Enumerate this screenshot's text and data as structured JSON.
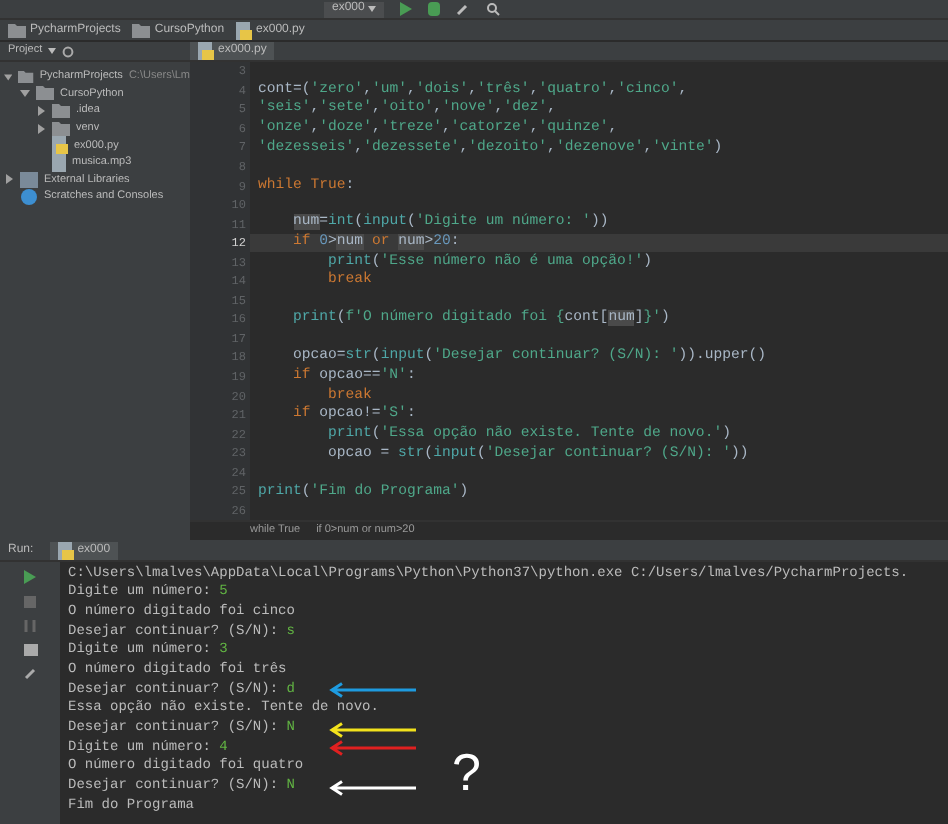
{
  "toolbar": {
    "run_config": "ex000"
  },
  "navigation_bar": [
    "PycharmProjects",
    "CursoPython",
    "ex000.py"
  ],
  "project_panel": {
    "title": "Project",
    "tree": [
      {
        "label": "PycharmProjects",
        "path": "C:\\Users\\Lm",
        "kind": "folder",
        "expanded": true,
        "children": [
          {
            "label": "CursoPython",
            "kind": "folder",
            "expanded": true,
            "children": [
              {
                "label": ".idea",
                "kind": "folder",
                "expanded": false
              },
              {
                "label": "venv",
                "kind": "folder",
                "expanded": false
              },
              {
                "label": "ex000.py",
                "kind": "python"
              },
              {
                "label": "musica.mp3",
                "kind": "file"
              }
            ]
          }
        ]
      },
      {
        "label": "External Libraries",
        "kind": "library",
        "expanded": false
      },
      {
        "label": "Scratches and Consoles",
        "kind": "scratch"
      }
    ]
  },
  "editor": {
    "tab": "ex000.py",
    "lines": [
      {
        "number": "3"
      },
      {
        "number": "4",
        "kind": "top",
        "segments": [
          {
            "kind": "plain",
            "text": "cont=("
          },
          {
            "kind": "str",
            "text": "'zero'"
          },
          {
            "kind": "plain",
            "text": ","
          },
          {
            "kind": "str",
            "text": "'um'"
          },
          {
            "kind": "plain",
            "text": ","
          },
          {
            "kind": "str",
            "text": "'dois'"
          },
          {
            "kind": "plain",
            "text": ","
          },
          {
            "kind": "str",
            "text": "'três'"
          },
          {
            "kind": "plain",
            "text": ","
          },
          {
            "kind": "str",
            "text": "'quatro'"
          },
          {
            "kind": "plain",
            "text": ","
          },
          {
            "kind": "str",
            "text": "'cinco'"
          },
          {
            "kind": "plain",
            "text": ","
          }
        ]
      },
      {
        "number": "5",
        "kind": "top",
        "segments": [
          {
            "kind": "str",
            "text": "'seis'"
          },
          {
            "kind": "plain",
            "text": ","
          },
          {
            "kind": "str",
            "text": "'sete'"
          },
          {
            "kind": "plain",
            "text": ","
          },
          {
            "kind": "str",
            "text": "'oito'"
          },
          {
            "kind": "plain",
            "text": ","
          },
          {
            "kind": "str",
            "text": "'nove'"
          },
          {
            "kind": "plain",
            "text": ","
          },
          {
            "kind": "str",
            "text": "'dez'"
          },
          {
            "kind": "plain",
            "text": ","
          }
        ]
      },
      {
        "number": "6",
        "kind": "top",
        "segments": [
          {
            "kind": "str",
            "text": "'onze'"
          },
          {
            "kind": "plain",
            "text": ","
          },
          {
            "kind": "str",
            "text": "'doze'"
          },
          {
            "kind": "plain",
            "text": ","
          },
          {
            "kind": "str",
            "text": "'treze'"
          },
          {
            "kind": "plain",
            "text": ","
          },
          {
            "kind": "str",
            "text": "'catorze'"
          },
          {
            "kind": "plain",
            "text": ","
          },
          {
            "kind": "str",
            "text": "'quinze'"
          },
          {
            "kind": "plain",
            "text": ","
          }
        ]
      },
      {
        "number": "7",
        "kind": "top",
        "segments": [
          {
            "kind": "str",
            "text": "'dezesseis'"
          },
          {
            "kind": "plain",
            "text": ","
          },
          {
            "kind": "str",
            "text": "'dezessete'"
          },
          {
            "kind": "plain",
            "text": ","
          },
          {
            "kind": "str",
            "text": "'dezoito'"
          },
          {
            "kind": "plain",
            "text": ","
          },
          {
            "kind": "str",
            "text": "'dezenove'"
          },
          {
            "kind": "plain",
            "text": ","
          },
          {
            "kind": "str",
            "text": "'vinte'"
          },
          {
            "kind": "plain",
            "text": ")"
          }
        ]
      },
      {
        "number": "8"
      },
      {
        "number": "9",
        "kind": "top",
        "segments": [
          {
            "kind": "kw",
            "text": "while True"
          },
          {
            "kind": "plain",
            "text": ":"
          }
        ]
      },
      {
        "number": "10"
      },
      {
        "number": "11",
        "kind": "body",
        "segments": [
          {
            "kind": "ref",
            "text": "num"
          },
          {
            "kind": "plain",
            "text": "="
          },
          {
            "kind": "fn",
            "text": "int"
          },
          {
            "kind": "plain",
            "text": "("
          },
          {
            "kind": "fn",
            "text": "input"
          },
          {
            "kind": "plain",
            "text": "("
          },
          {
            "kind": "str",
            "text": "'Digite um número: '"
          },
          {
            "kind": "plain",
            "text": "))"
          }
        ]
      },
      {
        "number": "12",
        "kind": "body",
        "current": true,
        "segments": [
          {
            "kind": "kw",
            "text": "if "
          },
          {
            "kind": "num",
            "text": "0"
          },
          {
            "kind": "plain",
            "text": ">"
          },
          {
            "kind": "ref",
            "text": "num"
          },
          {
            "kind": "kw",
            "text": " or "
          },
          {
            "kind": "ref",
            "text": "num"
          },
          {
            "kind": "plain",
            "text": ">"
          },
          {
            "kind": "num",
            "text": "20"
          },
          {
            "kind": "plain",
            "text": ":"
          }
        ]
      },
      {
        "number": "13",
        "kind": "inner",
        "segments": [
          {
            "kind": "fn",
            "text": "print"
          },
          {
            "kind": "plain",
            "text": "("
          },
          {
            "kind": "str",
            "text": "'Esse número não é uma opção!'"
          },
          {
            "kind": "plain",
            "text": ")"
          }
        ]
      },
      {
        "number": "14",
        "kind": "inner",
        "segments": [
          {
            "kind": "kw",
            "text": "break"
          }
        ]
      },
      {
        "number": "15"
      },
      {
        "number": "16",
        "kind": "body",
        "segments": [
          {
            "kind": "fn",
            "text": "print"
          },
          {
            "kind": "plain",
            "text": "("
          },
          {
            "kind": "str",
            "text": "f'O número digitado foi {"
          },
          {
            "kind": "plain",
            "text": "cont["
          },
          {
            "kind": "ref",
            "text": "num"
          },
          {
            "kind": "plain",
            "text": "]"
          },
          {
            "kind": "str",
            "text": "}'"
          },
          {
            "kind": "plain",
            "text": ")"
          }
        ]
      },
      {
        "number": "17"
      },
      {
        "number": "18",
        "kind": "body",
        "segments": [
          {
            "kind": "plain",
            "text": "opcao="
          },
          {
            "kind": "fn",
            "text": "str"
          },
          {
            "kind": "plain",
            "text": "("
          },
          {
            "kind": "fn",
            "text": "input"
          },
          {
            "kind": "plain",
            "text": "("
          },
          {
            "kind": "str",
            "text": "'Desejar continuar? (S/N): '"
          },
          {
            "kind": "plain",
            "text": ")).upper()"
          }
        ]
      },
      {
        "number": "19",
        "kind": "body",
        "segments": [
          {
            "kind": "kw",
            "text": "if "
          },
          {
            "kind": "plain",
            "text": "opcao=="
          },
          {
            "kind": "str",
            "text": "'N'"
          },
          {
            "kind": "plain",
            "text": ":"
          }
        ]
      },
      {
        "number": "20",
        "kind": "inner",
        "segments": [
          {
            "kind": "kw",
            "text": "break"
          }
        ]
      },
      {
        "number": "21",
        "kind": "body",
        "segments": [
          {
            "kind": "kw",
            "text": "if "
          },
          {
            "kind": "plain",
            "text": "opcao!="
          },
          {
            "kind": "str",
            "text": "'S'"
          },
          {
            "kind": "plain",
            "text": ":"
          }
        ]
      },
      {
        "number": "22",
        "kind": "inner",
        "segments": [
          {
            "kind": "fn",
            "text": "print"
          },
          {
            "kind": "plain",
            "text": "("
          },
          {
            "kind": "str",
            "text": "'Essa opção não existe. Tente de novo.'"
          },
          {
            "kind": "plain",
            "text": ")"
          }
        ]
      },
      {
        "number": "23",
        "kind": "inner",
        "segments": [
          {
            "kind": "plain",
            "text": "opcao = "
          },
          {
            "kind": "fn",
            "text": "str"
          },
          {
            "kind": "plain",
            "text": "("
          },
          {
            "kind": "fn",
            "text": "input"
          },
          {
            "kind": "plain",
            "text": "("
          },
          {
            "kind": "str",
            "text": "'Desejar continuar? (S/N): '"
          },
          {
            "kind": "plain",
            "text": "))"
          }
        ]
      },
      {
        "number": "24"
      },
      {
        "number": "25",
        "kind": "top",
        "segments": [
          {
            "kind": "fn",
            "text": "print"
          },
          {
            "kind": "plain",
            "text": "("
          },
          {
            "kind": "str",
            "text": "'Fim do Programa'"
          },
          {
            "kind": "plain",
            "text": ")"
          }
        ]
      },
      {
        "number": "26"
      }
    ],
    "breadcrumbs": [
      "while True",
      "if 0>num or num>20"
    ]
  },
  "run_panel": {
    "label": "Run:",
    "tab": "ex000",
    "console": [
      {
        "text": "C:\\Users\\lmalves\\AppData\\Local\\Programs\\Python\\Python37\\python.exe C:/Users/lmalves/PycharmProjects."
      },
      {
        "text": "Digite um número: ",
        "input": "5"
      },
      {
        "text": "O número digitado foi cinco"
      },
      {
        "text": "Desejar continuar? (S/N): ",
        "input": "s"
      },
      {
        "text": "Digite um número: ",
        "input": "3"
      },
      {
        "text": "O número digitado foi três"
      },
      {
        "text": "Desejar continuar? (S/N): ",
        "input": "d",
        "arrow": {
          "color": "#1e9be0"
        }
      },
      {
        "text": "Essa opção não existe. Tente de novo."
      },
      {
        "text": "Desejar continuar? (S/N): ",
        "input": "N",
        "arrow": {
          "color": "#f2e21c"
        }
      },
      {
        "text": "Digite um número: ",
        "input": "4",
        "arrow": {
          "color": "#e02020"
        }
      },
      {
        "text": "O número digitado foi quatro"
      },
      {
        "text": "Desejar continuar? (S/N): ",
        "input": "N",
        "arrow": {
          "color": "#ffffff"
        },
        "mark": "?"
      },
      {
        "text": "Fim do Programa"
      }
    ]
  }
}
